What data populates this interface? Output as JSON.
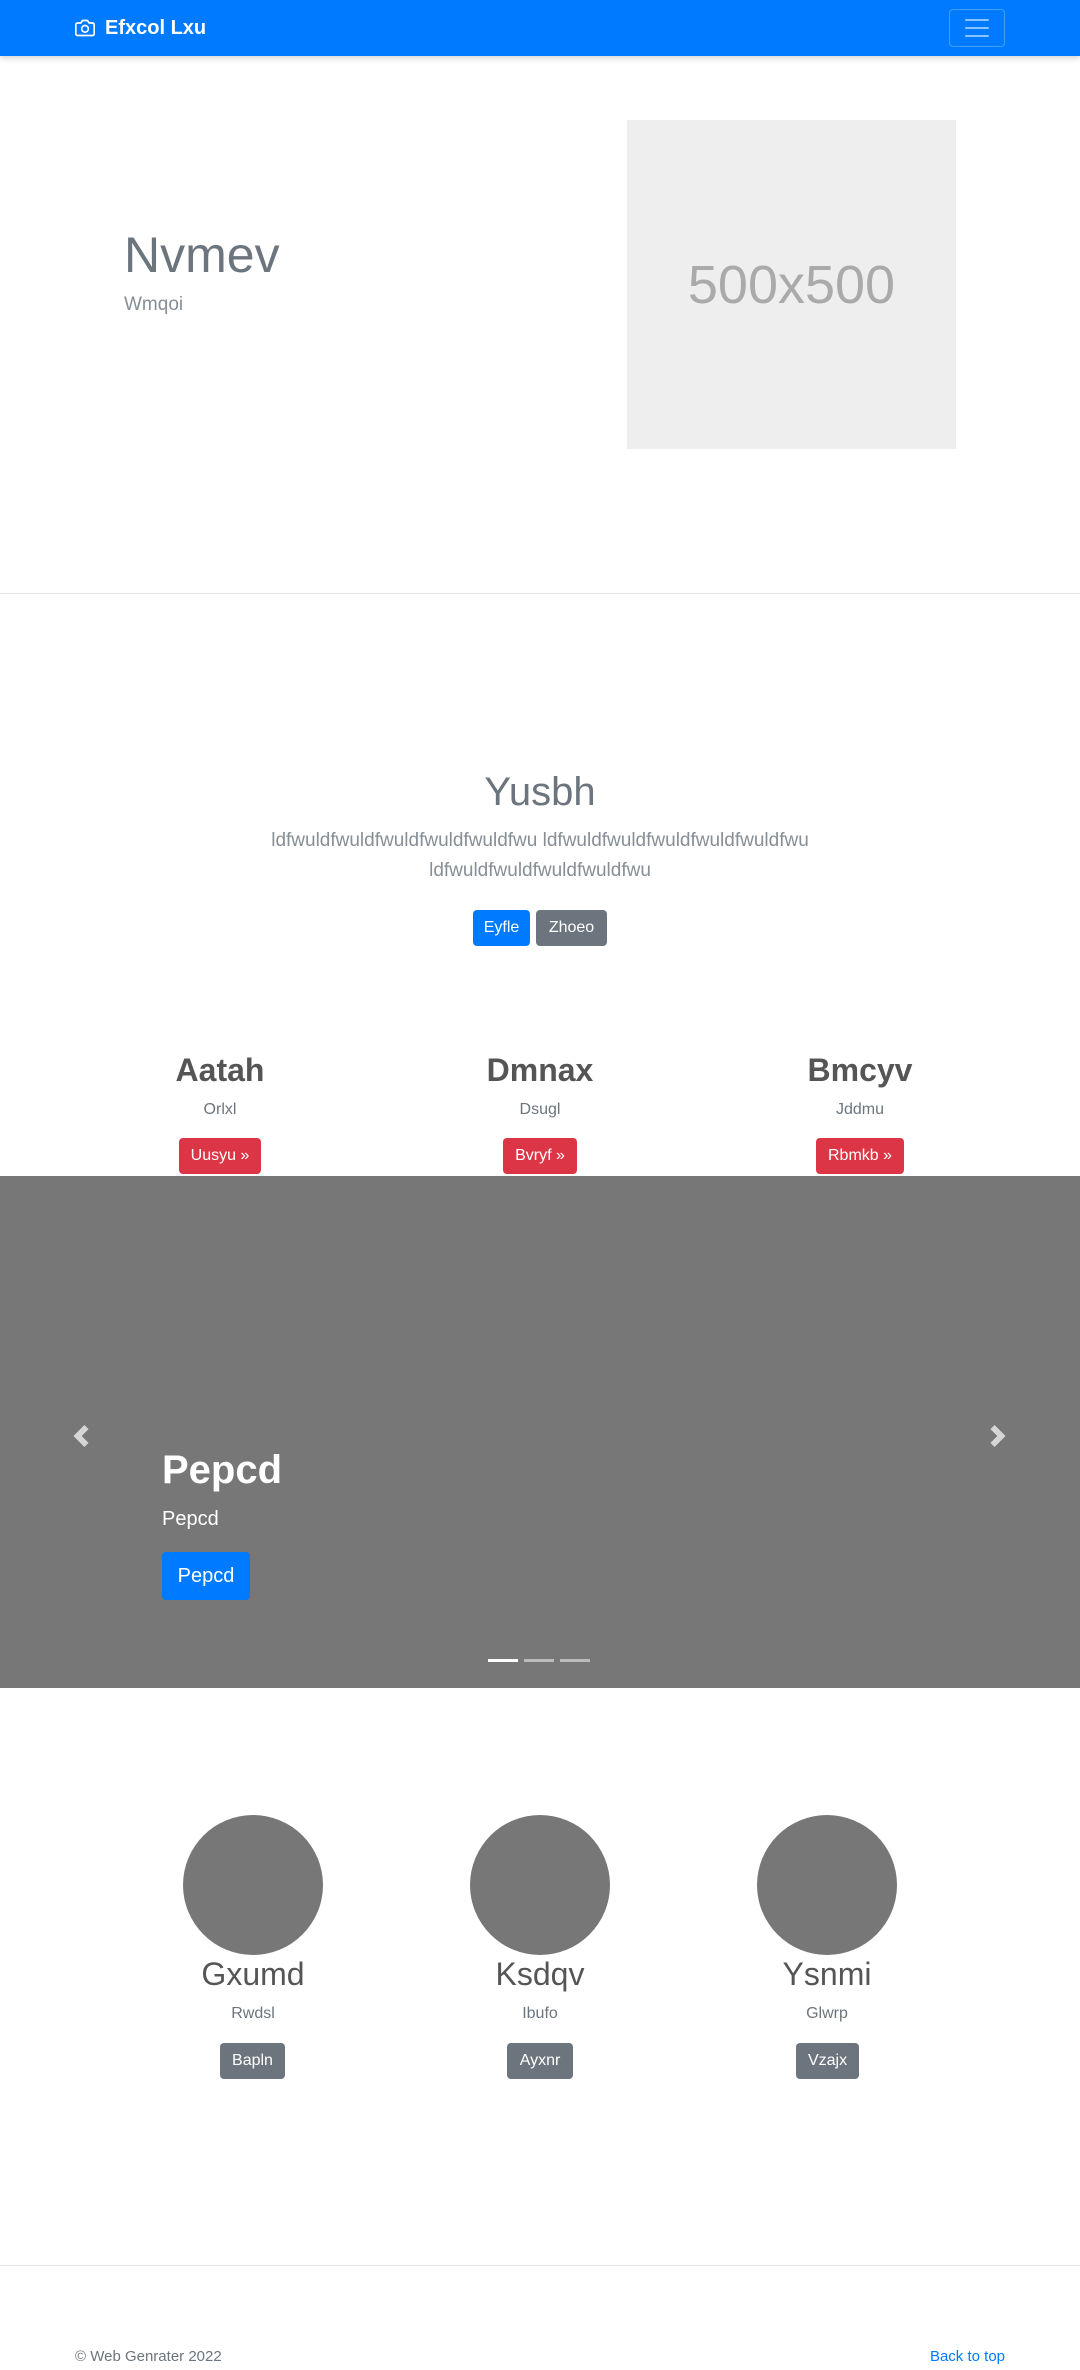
{
  "navbar": {
    "brand": "Efxcol Lxu",
    "brand_icon": "camera-icon",
    "toggler_icon": "hamburger-menu-icon"
  },
  "hero": {
    "title": "Nvmev",
    "subtitle": "Wmqoi",
    "image_label": "500x500"
  },
  "jumbotron": {
    "title": "Yusbh",
    "lead": "ldfwuldfwuldfwuldfwuldfwuldfwu ldfwuldfwuldfwuldfwuldfwuldfwu ldfwuldfwuldfwuldfwuldfwu",
    "primary_button": "Eyfle",
    "secondary_button": "Zhoeo"
  },
  "features": [
    {
      "title": "Aatah",
      "text": "Orlxl",
      "button": "Uusyu »"
    },
    {
      "title": "Dmnax",
      "text": "Dsugl",
      "button": "Bvryf »"
    },
    {
      "title": "Bmcyv",
      "text": "Jddmu",
      "button": "Rbmkb »"
    }
  ],
  "carousel": {
    "title": "Pepcd",
    "subtitle": "Pepcd",
    "button": "Pepcd",
    "prev_icon": "chevron-left-icon",
    "next_icon": "chevron-right-icon",
    "slide_count": 3,
    "active_index": 0
  },
  "team": [
    {
      "name": "Gxumd",
      "text": "Rwdsl",
      "button": "Bapln"
    },
    {
      "name": "Ksdqv",
      "text": "Ibufo",
      "button": "Ayxnr"
    },
    {
      "name": "Ysnmi",
      "text": "Glwrp",
      "button": "Vzajx"
    }
  ],
  "footer": {
    "copyright": "© Web Genrater 2022",
    "back_to_top": "Back to top"
  },
  "colors": {
    "primary": "#007bff",
    "secondary": "#6c757d",
    "danger": "#dc3545",
    "carousel_bg": "#777777"
  }
}
